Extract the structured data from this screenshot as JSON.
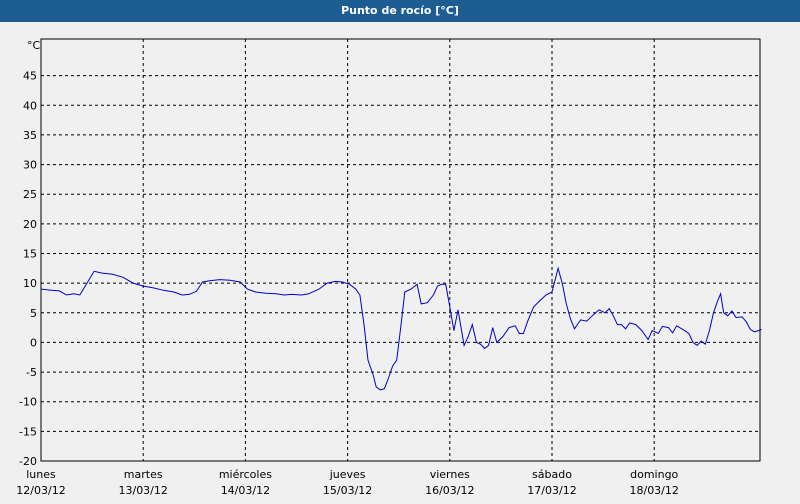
{
  "window": {
    "title": "Punto de rocío [°C]"
  },
  "chart_data": {
    "type": "line",
    "title": "Punto de rocío [°C]",
    "ylabel": "°C",
    "xlabel": "",
    "ylim": [
      -20,
      50
    ],
    "yticks": [
      -20,
      -15,
      -10,
      -5,
      0,
      5,
      10,
      15,
      20,
      25,
      30,
      35,
      40,
      45
    ],
    "xlim": [
      0,
      7.05
    ],
    "grid": true,
    "line_color": "#0000c8",
    "days": [
      {
        "day": "lunes",
        "date": "12/03/12"
      },
      {
        "day": "martes",
        "date": "13/03/12"
      },
      {
        "day": "miércoles",
        "date": "14/03/12"
      },
      {
        "day": "jueves",
        "date": "15/03/12"
      },
      {
        "day": "viernes",
        "date": "16/03/12"
      },
      {
        "day": "sábado",
        "date": "17/03/12"
      },
      {
        "day": "domingo",
        "date": "18/03/12"
      }
    ],
    "series": [
      {
        "points": [
          [
            0.0,
            9.0
          ],
          [
            0.1,
            8.8
          ],
          [
            0.18,
            8.7
          ],
          [
            0.25,
            8.0
          ],
          [
            0.32,
            8.2
          ],
          [
            0.38,
            8.0
          ],
          [
            0.45,
            10.0
          ],
          [
            0.52,
            12.0
          ],
          [
            0.6,
            11.7
          ],
          [
            0.7,
            11.5
          ],
          [
            0.8,
            11.0
          ],
          [
            0.9,
            10.0
          ],
          [
            1.0,
            9.5
          ],
          [
            1.1,
            9.2
          ],
          [
            1.2,
            8.8
          ],
          [
            1.3,
            8.5
          ],
          [
            1.38,
            8.0
          ],
          [
            1.45,
            8.1
          ],
          [
            1.52,
            8.6
          ],
          [
            1.58,
            10.2
          ],
          [
            1.65,
            10.4
          ],
          [
            1.75,
            10.6
          ],
          [
            1.85,
            10.5
          ],
          [
            1.95,
            10.2
          ],
          [
            2.02,
            9.0
          ],
          [
            2.1,
            8.5
          ],
          [
            2.2,
            8.3
          ],
          [
            2.3,
            8.2
          ],
          [
            2.38,
            8.0
          ],
          [
            2.45,
            8.1
          ],
          [
            2.55,
            8.0
          ],
          [
            2.62,
            8.2
          ],
          [
            2.72,
            9.0
          ],
          [
            2.8,
            10.0
          ],
          [
            2.88,
            10.3
          ],
          [
            2.95,
            10.2
          ],
          [
            3.02,
            9.8
          ],
          [
            3.08,
            9.0
          ],
          [
            3.12,
            8.0
          ],
          [
            3.16,
            3.0
          ],
          [
            3.2,
            -3.0
          ],
          [
            3.25,
            -5.5
          ],
          [
            3.28,
            -7.5
          ],
          [
            3.32,
            -8.0
          ],
          [
            3.36,
            -7.8
          ],
          [
            3.4,
            -6.0
          ],
          [
            3.44,
            -4.0
          ],
          [
            3.48,
            -3.0
          ],
          [
            3.52,
            2.5
          ],
          [
            3.56,
            8.5
          ],
          [
            3.62,
            9.0
          ],
          [
            3.68,
            9.8
          ],
          [
            3.72,
            6.5
          ],
          [
            3.78,
            6.7
          ],
          [
            3.84,
            8.0
          ],
          [
            3.88,
            9.5
          ],
          [
            3.92,
            9.8
          ],
          [
            3.96,
            9.8
          ],
          [
            4.0,
            6.0
          ],
          [
            4.04,
            2.0
          ],
          [
            4.08,
            5.5
          ],
          [
            4.14,
            -0.5
          ],
          [
            4.18,
            1.0
          ],
          [
            4.22,
            3.0
          ],
          [
            4.26,
            0.0
          ],
          [
            4.3,
            -0.3
          ],
          [
            4.34,
            -1.0
          ],
          [
            4.38,
            -0.5
          ],
          [
            4.42,
            2.5
          ],
          [
            4.46,
            0.0
          ],
          [
            4.52,
            1.0
          ],
          [
            4.58,
            2.5
          ],
          [
            4.64,
            2.8
          ],
          [
            4.68,
            1.5
          ],
          [
            4.72,
            1.5
          ],
          [
            4.76,
            3.5
          ],
          [
            4.82,
            6.0
          ],
          [
            4.88,
            7.0
          ],
          [
            4.94,
            8.0
          ],
          [
            5.0,
            8.5
          ],
          [
            5.06,
            12.5
          ],
          [
            5.1,
            10.0
          ],
          [
            5.14,
            6.5
          ],
          [
            5.18,
            4.0
          ],
          [
            5.22,
            2.3
          ],
          [
            5.28,
            3.8
          ],
          [
            5.34,
            3.6
          ],
          [
            5.4,
            4.6
          ],
          [
            5.46,
            5.5
          ],
          [
            5.52,
            5.0
          ],
          [
            5.56,
            5.7
          ],
          [
            5.6,
            4.5
          ],
          [
            5.64,
            3.0
          ],
          [
            5.68,
            3.0
          ],
          [
            5.72,
            2.3
          ],
          [
            5.76,
            3.3
          ],
          [
            5.82,
            3.0
          ],
          [
            5.88,
            2.0
          ],
          [
            5.94,
            0.5
          ],
          [
            5.98,
            2.0
          ],
          [
            6.04,
            1.5
          ],
          [
            6.08,
            2.7
          ],
          [
            6.14,
            2.5
          ],
          [
            6.18,
            1.6
          ],
          [
            6.22,
            2.8
          ],
          [
            6.28,
            2.2
          ],
          [
            6.34,
            1.5
          ],
          [
            6.38,
            0.0
          ],
          [
            6.42,
            -0.5
          ],
          [
            6.46,
            0.2
          ],
          [
            6.5,
            -0.3
          ],
          [
            6.54,
            2.0
          ],
          [
            6.58,
            5.0
          ],
          [
            6.62,
            7.0
          ],
          [
            6.65,
            8.2
          ],
          [
            6.68,
            5.0
          ],
          [
            6.72,
            4.5
          ],
          [
            6.76,
            5.3
          ],
          [
            6.8,
            4.2
          ],
          [
            6.86,
            4.3
          ],
          [
            6.9,
            3.5
          ],
          [
            6.94,
            2.2
          ],
          [
            6.98,
            1.8
          ],
          [
            7.02,
            2.0
          ],
          [
            7.05,
            2.2
          ]
        ]
      }
    ]
  }
}
